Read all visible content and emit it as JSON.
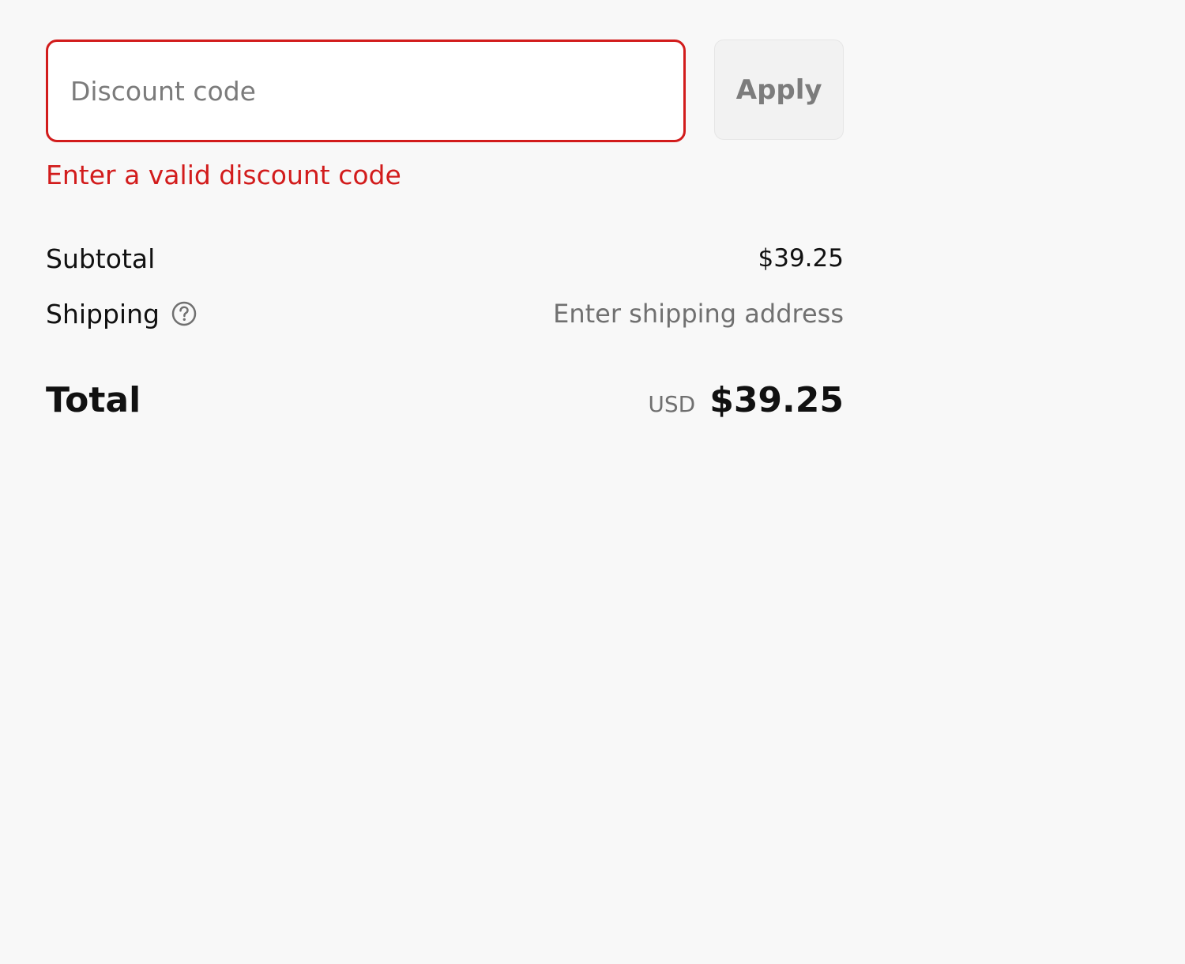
{
  "discount": {
    "placeholder": "Discount code",
    "value": "",
    "apply_label": "Apply",
    "error": "Enter a valid discount code",
    "error_color": "#d21c1c"
  },
  "summary": {
    "subtotal_label": "Subtotal",
    "subtotal_value": "$39.25",
    "shipping_label": "Shipping",
    "shipping_icon": "question-circle-icon",
    "shipping_value": "Enter shipping address",
    "total_label": "Total",
    "currency": "USD",
    "total_value": "$39.25"
  }
}
